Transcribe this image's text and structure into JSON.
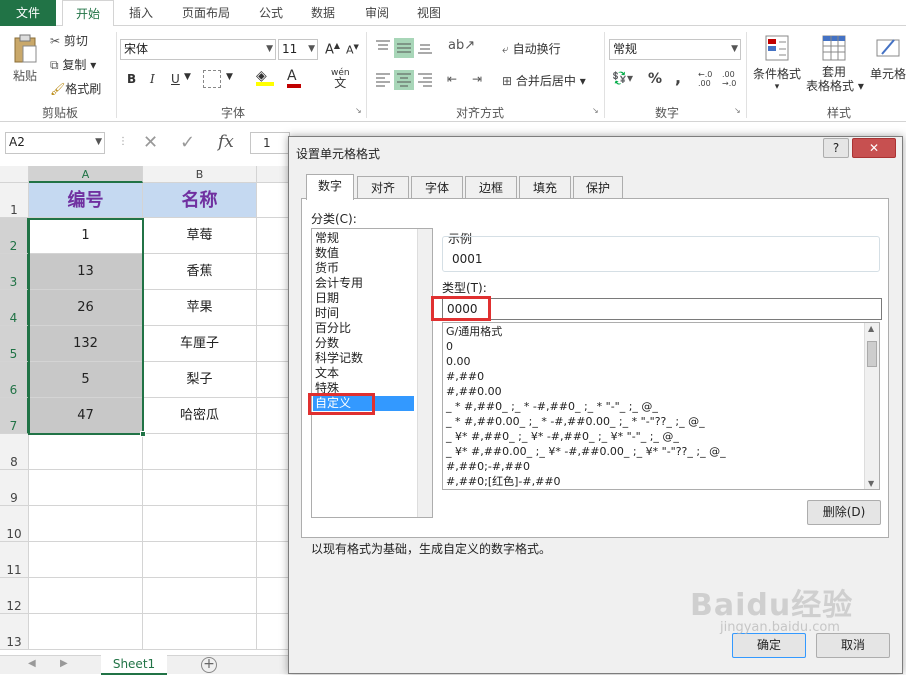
{
  "ribbon": {
    "tabs": [
      "文件",
      "开始",
      "插入",
      "页面布局",
      "公式",
      "数据",
      "审阅",
      "视图"
    ],
    "clipboard": {
      "paste": "粘贴",
      "cut": "剪切",
      "copy": "复制",
      "format_painter": "格式刷",
      "label": "剪贴板"
    },
    "font": {
      "name": "宋体",
      "size": "11",
      "label": "字体",
      "bold": "B",
      "italic": "I",
      "underline": "U",
      "grow": "A",
      "shrink": "A",
      "font_color": "A",
      "phonetic": "wén"
    },
    "alignment": {
      "wrap": "自动换行",
      "merge": "合并后居中",
      "label": "对齐方式"
    },
    "number": {
      "format": "常规",
      "label": "数字",
      "percent": "%",
      "comma": ","
    },
    "styles": {
      "conditional": "条件格式",
      "table": "套用\n表格格式",
      "cell": "单元格样式",
      "label": "样式",
      "table_line1": "套用",
      "table_line2": "表格格式",
      "cell_short": "单元格"
    }
  },
  "formula_bar": {
    "name_box": "A2",
    "fx": "fx",
    "value": "1"
  },
  "sheet": {
    "columns": [
      "A",
      "B"
    ],
    "rows": [
      "1",
      "2",
      "3",
      "4",
      "5",
      "6",
      "7",
      "8",
      "9",
      "10",
      "11",
      "12",
      "13"
    ],
    "header": {
      "a": "编号",
      "b": "名称"
    },
    "data": [
      {
        "a": "1",
        "b": "草莓"
      },
      {
        "a": "13",
        "b": "香蕉"
      },
      {
        "a": "26",
        "b": "苹果"
      },
      {
        "a": "132",
        "b": "车厘子"
      },
      {
        "a": "5",
        "b": "梨子"
      },
      {
        "a": "47",
        "b": "哈密瓜"
      }
    ],
    "tab": "Sheet1"
  },
  "dialog": {
    "title": "设置单元格格式",
    "help": "?",
    "close": "✕",
    "tabs": [
      "数字",
      "对齐",
      "字体",
      "边框",
      "填充",
      "保护"
    ],
    "category_label": "分类(C):",
    "categories": [
      "常规",
      "数值",
      "货币",
      "会计专用",
      "日期",
      "时间",
      "百分比",
      "分数",
      "科学记数",
      "文本",
      "特殊",
      "自定义"
    ],
    "sample_label": "示例",
    "sample_value": "0001",
    "type_label": "类型(T):",
    "type_value": "0000",
    "formats": [
      "G/通用格式",
      "0",
      "0.00",
      "#,##0",
      "#,##0.00",
      "_ * #,##0_ ;_ * -#,##0_ ;_ * \"-\"_ ;_ @_",
      "_ * #,##0.00_ ;_ * -#,##0.00_ ;_ * \"-\"??_ ;_ @_",
      "_ ¥* #,##0_ ;_ ¥* -#,##0_ ;_ ¥* \"-\"_ ;_ @_",
      "_ ¥* #,##0.00_ ;_ ¥* -#,##0.00_ ;_ ¥* \"-\"??_ ;_ @_",
      "#,##0;-#,##0",
      "#,##0;[红色]-#,##0"
    ],
    "delete": "删除(D)",
    "description": "以现有格式为基础，生成自定义的数字格式。",
    "ok": "确定",
    "cancel": "取消"
  },
  "watermark": {
    "brand": "Baidu经验",
    "url": "jingyan.baidu.com"
  },
  "colors": {
    "excel_green": "#217346",
    "header_fill": "#c5d9f1",
    "header_text": "#7030a0",
    "highlight_red": "#e03030",
    "select_blue": "#3399ff",
    "gray_fill": "#c8c8c8"
  }
}
